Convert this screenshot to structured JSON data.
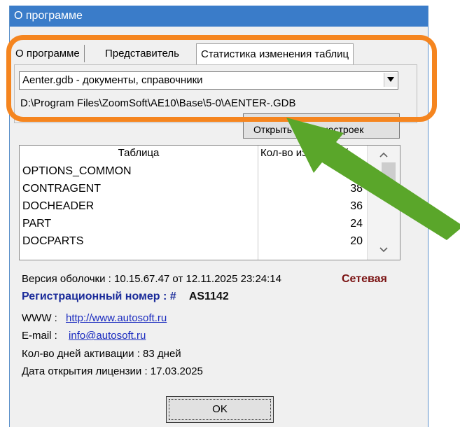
{
  "window": {
    "title": "О программе"
  },
  "tabs": [
    {
      "label": "О программе"
    },
    {
      "label": "Представитель"
    },
    {
      "label": "Статистика изменения таблиц"
    }
  ],
  "database_select": {
    "value": "Aenter.gdb - документы, справочники"
  },
  "db_path": "D:\\Program Files\\ZoomSoft\\AE10\\Base\\5-0\\AENTER-.GDB",
  "hidden_button": {
    "label": "Открыть папку настроек"
  },
  "table": {
    "headers": [
      "Таблица",
      "Кол-во изменений"
    ],
    "rows": [
      {
        "name": "OPTIONS_COMMON",
        "count": ""
      },
      {
        "name": "CONTRAGENT",
        "count": "38"
      },
      {
        "name": "DOCHEADER",
        "count": "36"
      },
      {
        "name": "PART",
        "count": "24"
      },
      {
        "name": "DOCPARTS",
        "count": "20"
      }
    ]
  },
  "info": {
    "version_label": "Версия оболочки :",
    "version": "10.15.67.47 от 12.11.2025 23:24:14",
    "network": "Сетевая",
    "reg_label": "Регистрационный номер : #",
    "reg_value": "AS1142",
    "www_label": "WWW :",
    "www": "http://www.autosoft.ru",
    "email_label": "E-mail :",
    "email": "info@autosoft.ru",
    "activation": "Кол-во дней активации : 83 дней",
    "license_date": "Дата открытия лицензии : 17.03.2025"
  },
  "ok_button": {
    "label": "OK"
  },
  "colors": {
    "highlight": "#f5851f",
    "arrow": "#5aa62a",
    "titlebar": "#3a7cc9"
  }
}
